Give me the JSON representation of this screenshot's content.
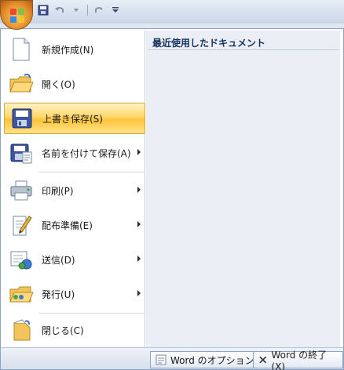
{
  "quick_access": {
    "save_icon": "save-icon",
    "undo_icon": "undo-icon",
    "redo_icon": "redo-icon",
    "customize_icon": "dropdown-icon"
  },
  "menu": {
    "items": [
      {
        "label": "新規作成(N)",
        "icon": "new-document-icon",
        "submenu": false
      },
      {
        "label": "開く(O)",
        "icon": "open-folder-icon",
        "submenu": false
      },
      {
        "label": "上書き保存(S)",
        "icon": "save-icon",
        "submenu": false,
        "selected": true
      },
      {
        "label": "名前を付けて保存(A)",
        "icon": "save-as-icon",
        "submenu": true
      },
      {
        "label": "印刷(P)",
        "icon": "print-icon",
        "submenu": true
      },
      {
        "label": "配布準備(E)",
        "icon": "prepare-icon",
        "submenu": true
      },
      {
        "label": "送信(D)",
        "icon": "send-icon",
        "submenu": true
      },
      {
        "label": "発行(U)",
        "icon": "publish-icon",
        "submenu": true
      },
      {
        "label": "閉じる(C)",
        "icon": "close-document-icon",
        "submenu": false
      }
    ]
  },
  "recent": {
    "title": "最近使用したドキュメント"
  },
  "footer": {
    "options_label": "Word のオプション(I)",
    "exit_label": "Word の終了(X)"
  },
  "colors": {
    "selected_bg": "#ffd66b",
    "panel_border": "#8ea3c2",
    "right_pane": "#ebeef4"
  }
}
